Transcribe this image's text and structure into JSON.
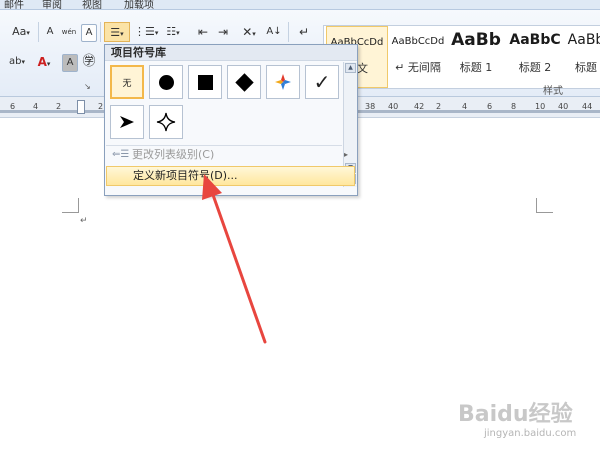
{
  "tabs": [
    {
      "label": "邮件"
    },
    {
      "label": "审阅"
    },
    {
      "label": "视图"
    },
    {
      "label": "加载项"
    }
  ],
  "ribbon": {
    "font_size_label": "Aa",
    "change_case_label": "Aa",
    "phonetic_label": "wén",
    "styles_group_label": "样式",
    "ruler_numbers": [
      "6",
      "4",
      "2",
      "2",
      "4",
      "6",
      "8",
      "10",
      "38",
      "40",
      "42",
      "44"
    ]
  },
  "styles_gallery": [
    {
      "sample": "AaBbCcDd",
      "name": "正文"
    },
    {
      "sample": "AaBbCcDd",
      "name": "↵ 无间隔"
    },
    {
      "sample": "AaBb",
      "name": "标题 1"
    },
    {
      "sample": "AaBbC",
      "name": "标题 2"
    },
    {
      "sample": "AaBb",
      "name": "标题"
    }
  ],
  "bullet_menu": {
    "title": "项目符号库",
    "library": [
      {
        "symbol": "无",
        "icon": "none-bullet"
      },
      {
        "symbol": "●",
        "icon": "filled-circle-bullet"
      },
      {
        "symbol": "■",
        "icon": "filled-square-bullet"
      },
      {
        "symbol": "◆",
        "icon": "filled-diamond-bullet"
      },
      {
        "symbol": "✦",
        "icon": "four-arrow-bullet"
      },
      {
        "symbol": "✓",
        "icon": "checkmark-bullet"
      },
      {
        "symbol": "➤",
        "icon": "arrowhead-bullet"
      },
      {
        "symbol": "✧",
        "icon": "four-point-star-bullet"
      }
    ],
    "change_list_level": "更改列表级别(C)",
    "define_new_bullet": "定义新项目符号(D)..."
  },
  "watermark": {
    "logo": "Baidu经验",
    "url": "jingyan.baidu.com"
  },
  "colors": {
    "highlight_menu": "#ffe79e",
    "selected_cell_border": "#f3b84b",
    "arrow": "#e8463f"
  }
}
